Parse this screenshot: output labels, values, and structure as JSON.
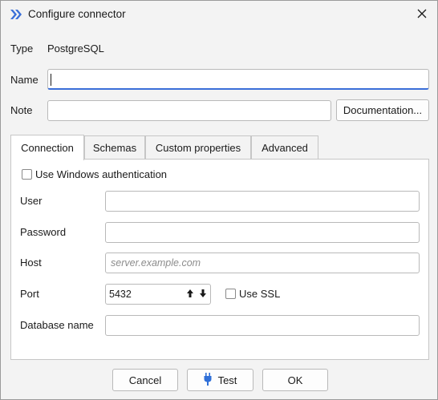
{
  "window": {
    "title": "Configure connector"
  },
  "form": {
    "type_label": "Type",
    "type_value": "PostgreSQL",
    "name_label": "Name",
    "name_value": "",
    "note_label": "Note",
    "note_value": "",
    "documentation_button": "Documentation..."
  },
  "tabs": [
    {
      "label": "Connection",
      "active": true
    },
    {
      "label": "Schemas",
      "active": false
    },
    {
      "label": "Custom properties",
      "active": false
    },
    {
      "label": "Advanced",
      "active": false
    }
  ],
  "connection": {
    "windows_auth_label": "Use Windows authentication",
    "windows_auth_checked": false,
    "user_label": "User",
    "user_value": "",
    "password_label": "Password",
    "password_value": "",
    "host_label": "Host",
    "host_placeholder": "server.example.com",
    "port_label": "Port",
    "port_value": "5432",
    "ssl_label": "Use SSL",
    "ssl_checked": false,
    "database_label": "Database name",
    "database_value": ""
  },
  "footer": {
    "cancel": "Cancel",
    "test": "Test",
    "ok": "OK"
  },
  "colors": {
    "focus_accent": "#3a6fd8",
    "app_icon": "#3a6fd8",
    "test_plug": "#2f6fd8"
  },
  "icons": {
    "app": "connector-app-icon",
    "close": "close-icon",
    "plug": "plug-icon",
    "spin_up": "arrow-up-icon",
    "spin_down": "arrow-down-icon"
  }
}
